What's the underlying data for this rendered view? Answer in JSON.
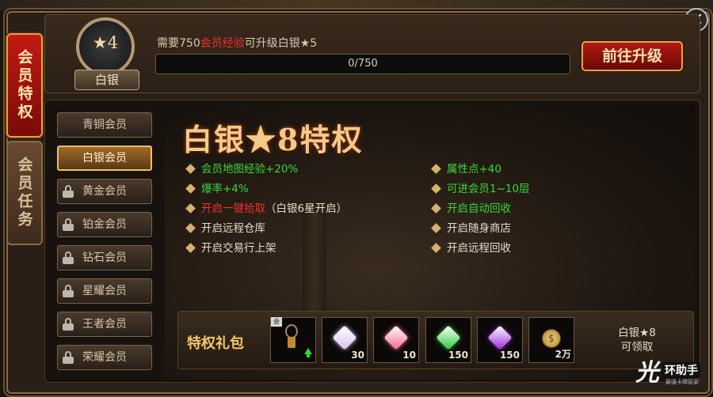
{
  "side_tabs": [
    "会员特权",
    "会员任务"
  ],
  "header": {
    "badge_star_level": "★4",
    "badge_rank": "白银",
    "requirement_prefix": "需要750",
    "requirement_highlight": "会员经验",
    "requirement_suffix": "可升级白银★5",
    "progress_current": 0,
    "progress_max": 750,
    "progress_text": "0/750",
    "upgrade_button": "前往升级"
  },
  "levels": [
    {
      "label": "青铜会员",
      "locked": false,
      "selected": false
    },
    {
      "label": "白银会员",
      "locked": false,
      "selected": true
    },
    {
      "label": "黄金会员",
      "locked": true,
      "selected": false
    },
    {
      "label": "铂金会员",
      "locked": true,
      "selected": false
    },
    {
      "label": "钻石会员",
      "locked": true,
      "selected": false
    },
    {
      "label": "星耀会员",
      "locked": true,
      "selected": false
    },
    {
      "label": "王者会员",
      "locked": true,
      "selected": false
    },
    {
      "label": "荣耀会员",
      "locked": true,
      "selected": false
    }
  ],
  "privilege_title": "白银★8特权",
  "perks_left": [
    {
      "text": "会员地图经验+20%",
      "color": "green"
    },
    {
      "text": "爆率+4%",
      "color": "green"
    },
    {
      "text": "开启一键拾取",
      "suffix": "（白银6星开启）",
      "color": "red"
    },
    {
      "text": "开启远程仓库",
      "color": "white"
    },
    {
      "text": "开启交易行上架",
      "color": "white"
    }
  ],
  "perks_right": [
    {
      "text": "属性点+40",
      "color": "green"
    },
    {
      "text": "可进会员1~10层",
      "color": "green"
    },
    {
      "text": "开启自动回收",
      "color": "green"
    },
    {
      "text": "开启随身商店",
      "color": "white"
    },
    {
      "text": "开启远程回收",
      "color": "white"
    }
  ],
  "gift": {
    "label": "特权礼包",
    "items": [
      {
        "icon": "amulet-icon",
        "count": "",
        "tag": "vip"
      },
      {
        "icon": "purple-diamond-icon",
        "count": "30",
        "color": "#d9c4f0"
      },
      {
        "icon": "pink-diamond-icon",
        "count": "10",
        "color": "#f06a8a"
      },
      {
        "icon": "green-gem-icon",
        "count": "150",
        "color": "#2ec83a"
      },
      {
        "icon": "purple-gem-icon",
        "count": "150",
        "color": "#9a2ad8"
      },
      {
        "icon": "gold-coin-icon",
        "count": "2万",
        "color": "#e2b448"
      }
    ],
    "claim_level": "白银★8",
    "claim_status": "可领取"
  },
  "watermark": {
    "brand": "环助手",
    "sub": "最强卡牌管家"
  },
  "colors": {
    "accent_red": "#b21a14",
    "gold": "#f3ca88",
    "green": "#36d838",
    "red": "#f0302a"
  }
}
